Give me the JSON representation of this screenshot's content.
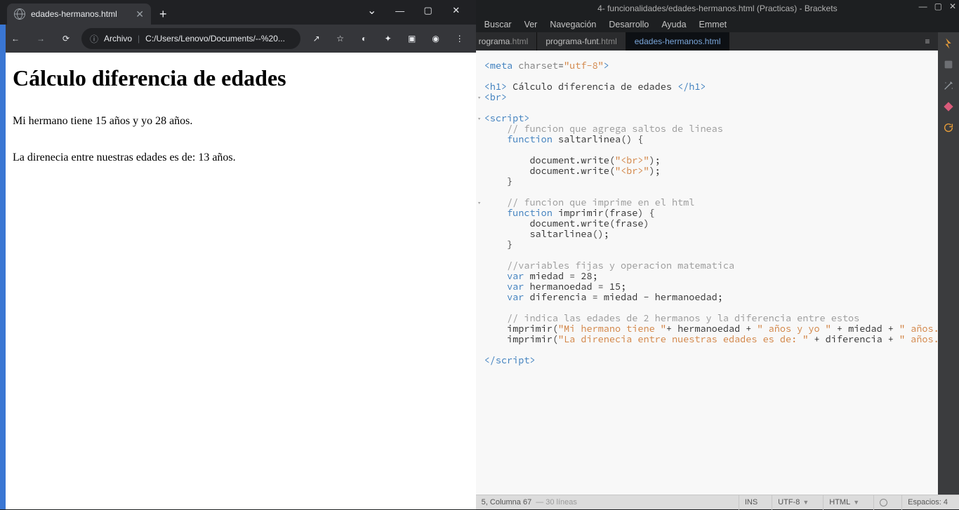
{
  "browser": {
    "tab_title": "edades-hermanos.html",
    "new_tab_glyph": "+",
    "winctl": {
      "dd": "⌄",
      "min": "—",
      "max": "▢",
      "close": "✕"
    },
    "nav": {
      "back": "←",
      "fwd": "→",
      "reload": "⟳"
    },
    "omnibox": {
      "info": "ⓘ",
      "label": "Archivo",
      "sep": "|",
      "path": "C:/Users/Lenovo/Documents/--%20..."
    },
    "icons": {
      "share": "↗",
      "star": "☆",
      "update": "◐",
      "ext": "✦",
      "panel": "▣",
      "profile": "◉",
      "menu": "⋮"
    }
  },
  "page": {
    "h1": "Cálculo diferencia de edades",
    "line1": "Mi hermano tiene 15 años y yo 28 años.",
    "line2": "La direnecia entre nuestras edades es de: 13 años."
  },
  "editor": {
    "title": "4- funcionalidades/edades-hermanos.html (Practicas) - Brackets",
    "winctl": {
      "min": "—",
      "max": "▢",
      "close": "✕"
    },
    "menu": [
      "Buscar",
      "Ver",
      "Navegación",
      "Desarrollo",
      "Ayuda",
      "Emmet"
    ],
    "tabs": [
      {
        "name": "rograma",
        "ext": ".html",
        "active": false,
        "cut": true
      },
      {
        "name": "programa-funt",
        "ext": ".html",
        "active": false
      },
      {
        "name": "edades-hermanos.html",
        "ext": "",
        "active": true
      }
    ],
    "tabs_right": "≡",
    "gutter": [
      "",
      "",
      "",
      "▾",
      "",
      "▾",
      "",
      "",
      "",
      "",
      "",
      "",
      "",
      "▾",
      "",
      "",
      "",
      "",
      "",
      "",
      "",
      "",
      "",
      "",
      "",
      "",
      "",
      "",
      ""
    ],
    "sidebar_icons": [
      "bolt",
      "ext",
      "wand",
      "git",
      "reload"
    ],
    "statusbar": {
      "pos": "5, Columna 67",
      "lines": "— 30 líneas",
      "ins": "INS",
      "enc": "UTF-8",
      "lang": "HTML",
      "spaces": "Espacios: 4"
    }
  }
}
